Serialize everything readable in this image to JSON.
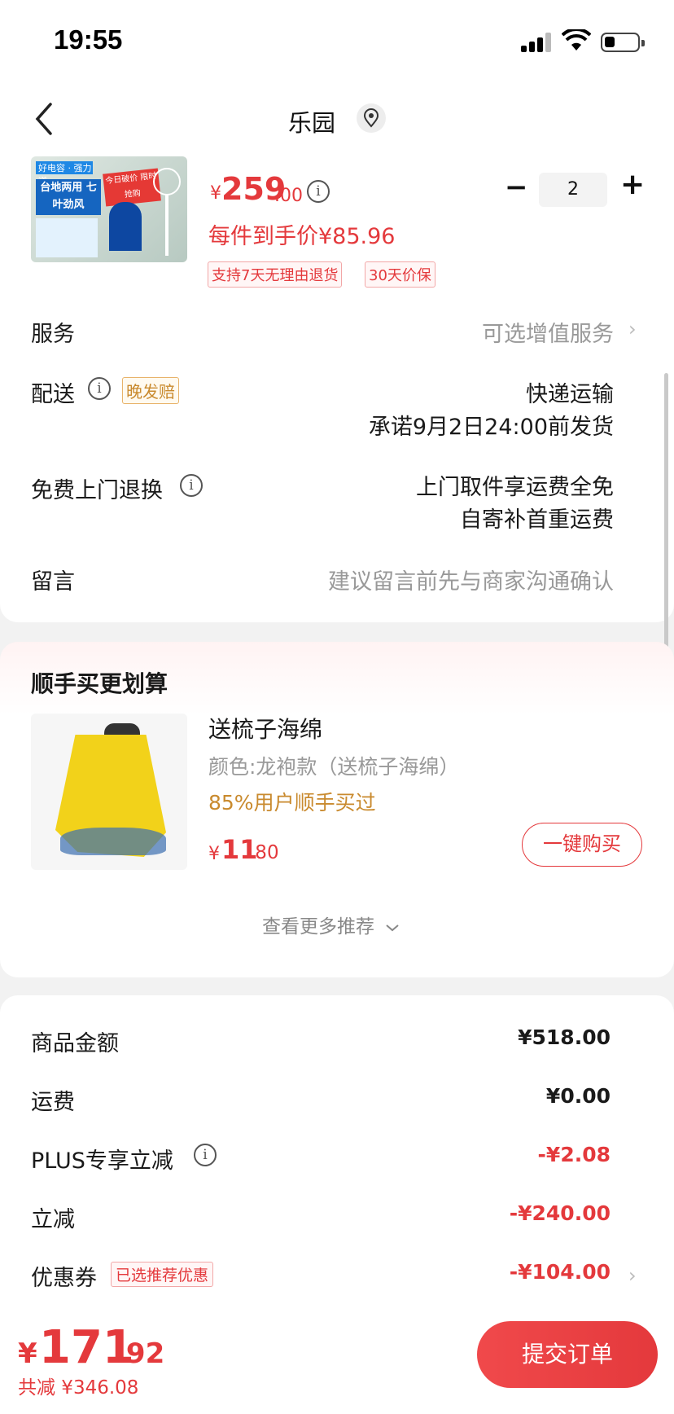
{
  "status_bar": {
    "time": "19:55"
  },
  "header": {
    "store_name": "乐园"
  },
  "product": {
    "price_currency": "¥",
    "price_int": "259",
    "price_dec": ".00",
    "per_item_price": "每件到手价¥85.96",
    "quantity": "2",
    "tags": [
      "支持7天无理由退货",
      "30天价保"
    ],
    "thumbnail_text": {
      "badge": "好电容 · 强力道",
      "main": "台地两用 七叶劲风",
      "promo": "今日破价 限时抢购"
    }
  },
  "service": {
    "label": "服务",
    "value": "可选增值服务"
  },
  "delivery": {
    "label": "配送",
    "tag": "晚发赔",
    "line1": "快递运输",
    "line2": "承诺9月2日24:00前发货"
  },
  "free_return": {
    "label": "免费上门退换",
    "line1": "上门取件享运费全免",
    "line2": "自寄补首重运费"
  },
  "message": {
    "label": "留言",
    "placeholder": "建议留言前先与商家沟通确认"
  },
  "addon": {
    "title": "顺手买更划算",
    "item_name": "送梳子海绵",
    "item_color": "颜色:龙袍款（送梳子海绵）",
    "item_pct": "85%用户顺手买过",
    "price_currency": "¥",
    "price_int": "11",
    "price_dec": ".80",
    "buy_label": "一键购买",
    "more_label": "查看更多推荐"
  },
  "summary": {
    "goods_label": "商品金额",
    "goods_value": "¥518.00",
    "freight_label": "运费",
    "freight_value": "¥0.00",
    "plus_label": "PLUS专享立减",
    "plus_value": "-¥2.08",
    "discount_label": "立减",
    "discount_value": "-¥240.00",
    "coupon_label": "优惠券",
    "coupon_tag": "已选推荐优惠",
    "coupon_value": "-¥104.00"
  },
  "bottom": {
    "total_currency": "¥",
    "total_int": "171",
    "total_dec": ".92",
    "saved": "共减 ¥346.08",
    "submit_label": "提交订单"
  },
  "colors": {
    "accent": "#e4393c",
    "gold": "#c98a2e",
    "muted": "#999999"
  }
}
